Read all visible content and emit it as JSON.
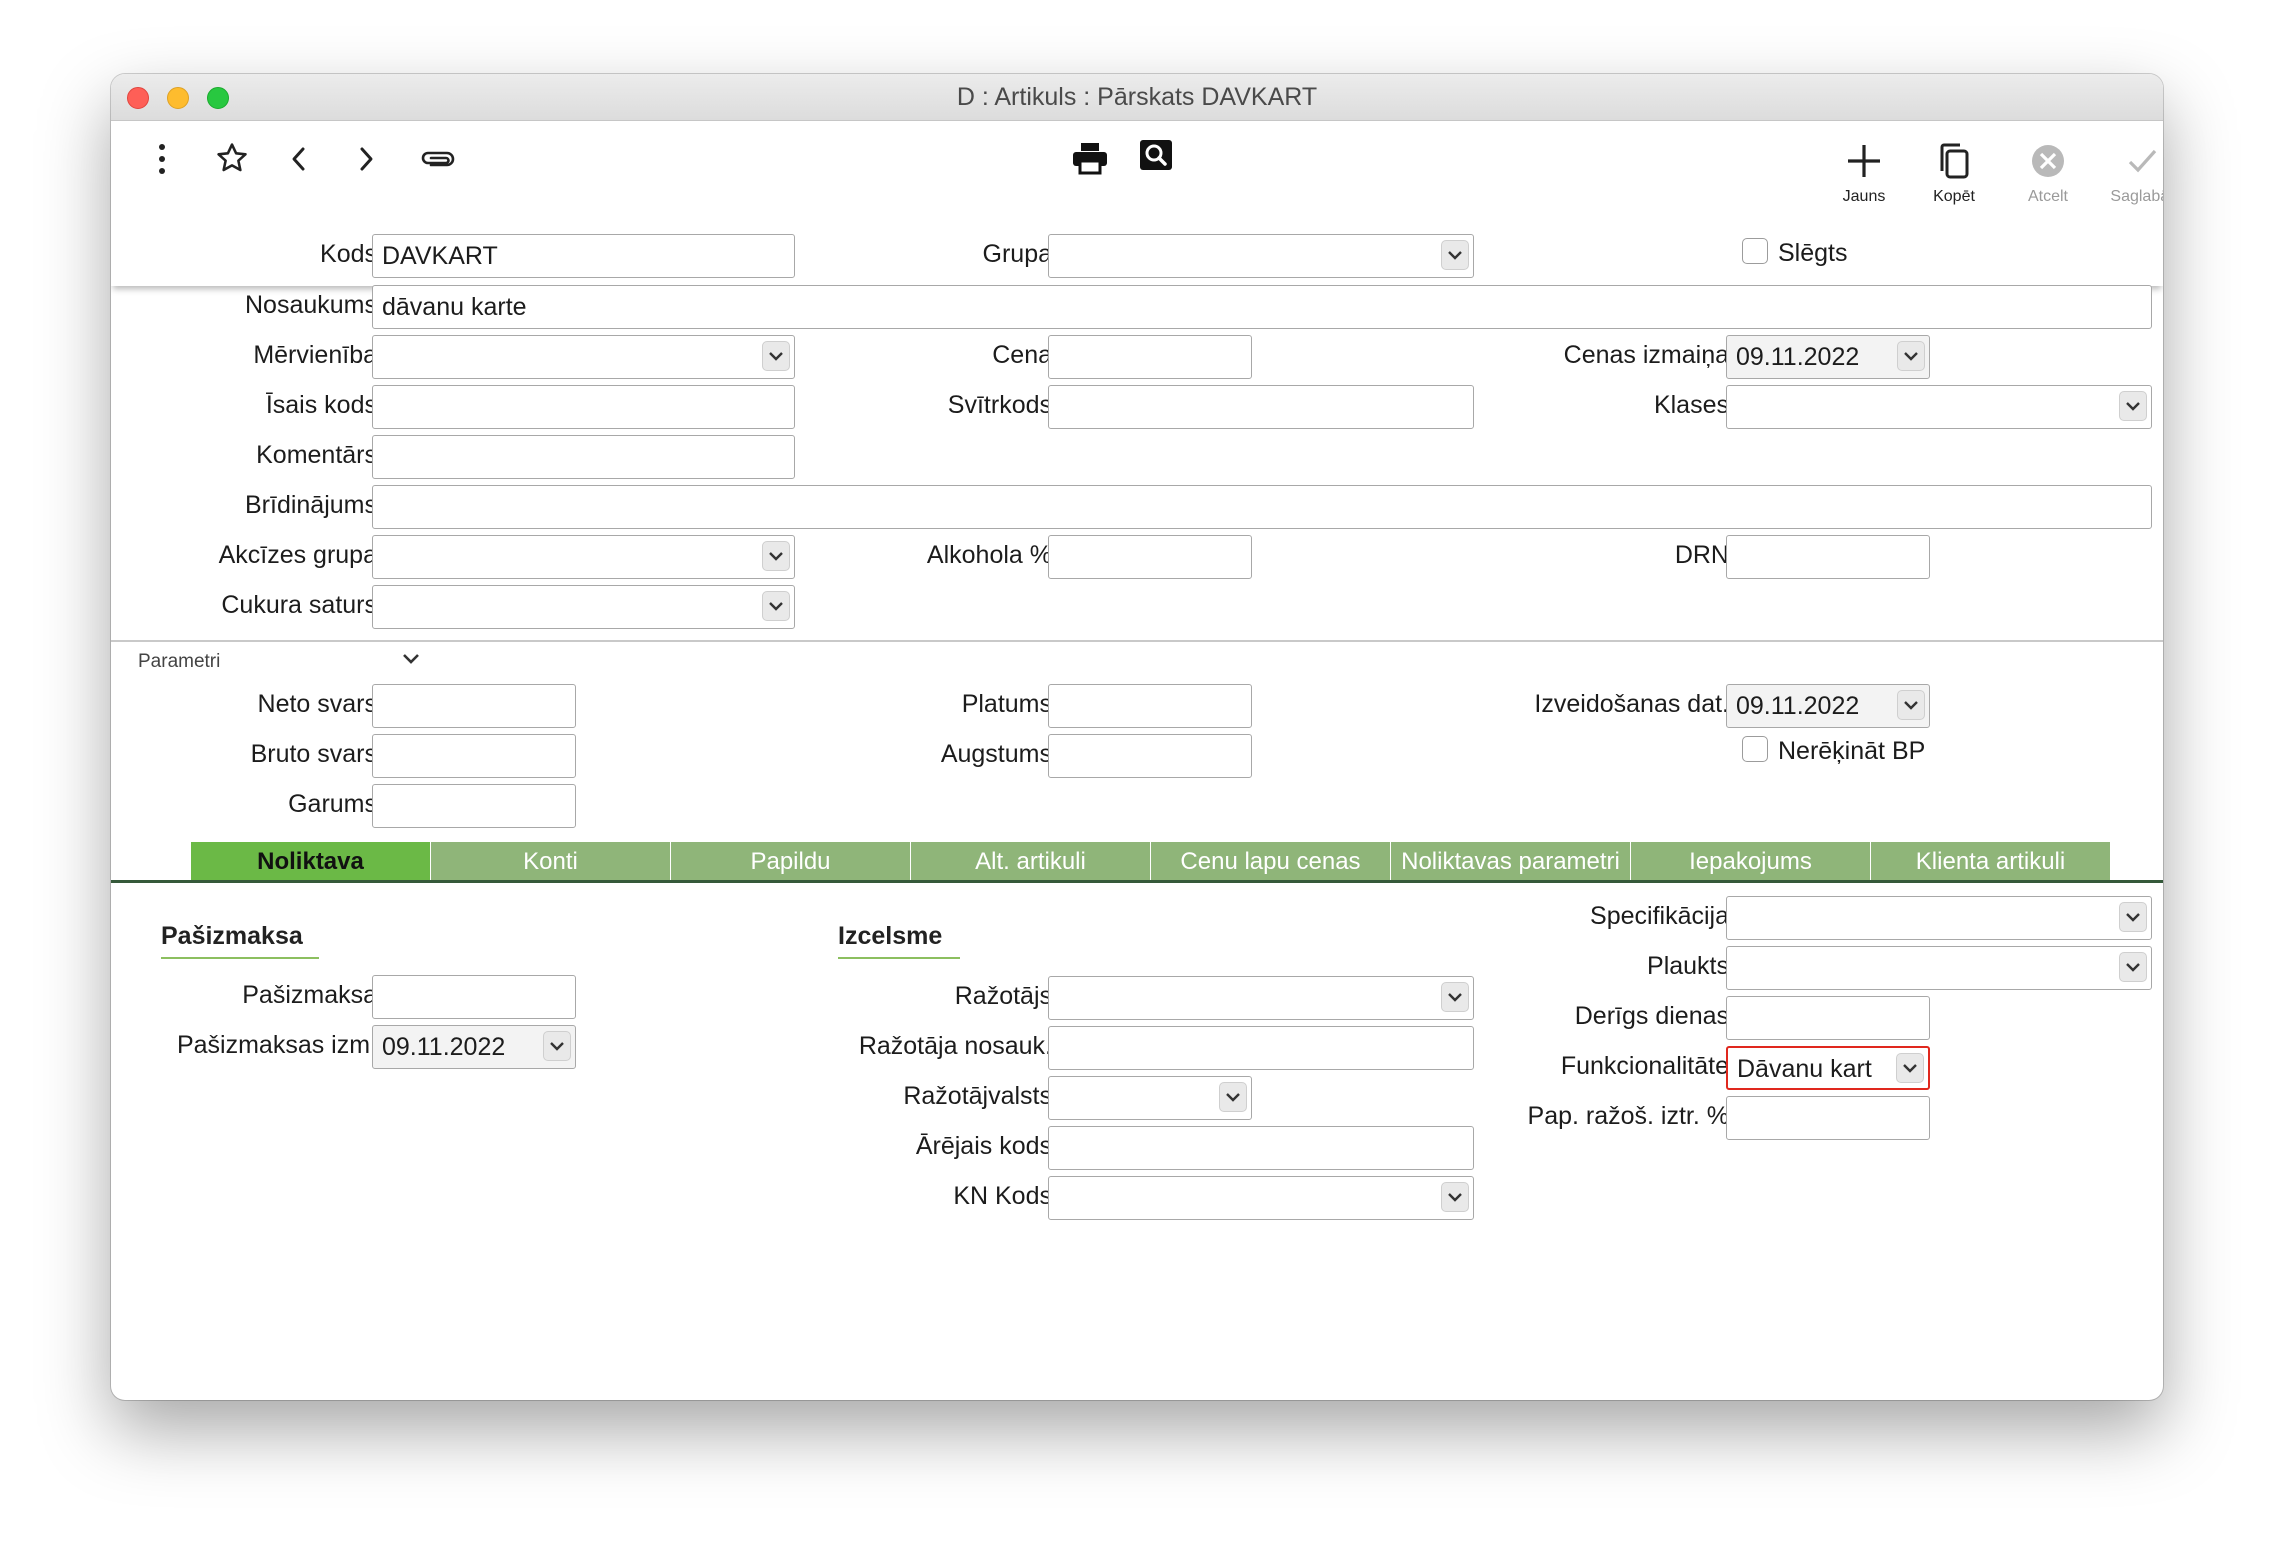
{
  "window": {
    "title": "D : Artikuls : Pārskats DAVKART"
  },
  "toolbar": {
    "new_label": "Jauns",
    "copy_label": "Kopēt",
    "cancel_label": "Atcelt",
    "save_label": "Saglabāt"
  },
  "form": {
    "kods": {
      "label": "Kods",
      "value": "DAVKART"
    },
    "grupa": {
      "label": "Grupa",
      "value": ""
    },
    "slegts": {
      "label": "Slēgts",
      "checked": false
    },
    "nosaukums": {
      "label": "Nosaukums",
      "value": "dāvanu karte"
    },
    "mervieniba": {
      "label": "Mērvienība",
      "value": ""
    },
    "cena": {
      "label": "Cena",
      "value": ""
    },
    "cenas_izmaina": {
      "label": "Cenas izmaiņa",
      "value": "09.11.2022"
    },
    "isais_kods": {
      "label": "Īsais kods",
      "value": ""
    },
    "svitrkods": {
      "label": "Svītrkods",
      "value": ""
    },
    "klases": {
      "label": "Klases",
      "value": ""
    },
    "komentars": {
      "label": "Komentārs",
      "value": ""
    },
    "bridinajums": {
      "label": "Brīdinājums",
      "value": ""
    },
    "akcizes_grupa": {
      "label": "Akcīzes grupa",
      "value": ""
    },
    "alkohola": {
      "label": "Alkohola %",
      "value": ""
    },
    "drn": {
      "label": "DRN",
      "value": ""
    },
    "cukura_saturs": {
      "label": "Cukura saturs",
      "value": ""
    }
  },
  "parametri": {
    "label": "Parametri",
    "neto_svars": {
      "label": "Neto svars",
      "value": ""
    },
    "bruto_svars": {
      "label": "Bruto svars",
      "value": ""
    },
    "garums": {
      "label": "Garums",
      "value": ""
    },
    "platums": {
      "label": "Platums",
      "value": ""
    },
    "augstums": {
      "label": "Augstums",
      "value": ""
    },
    "izveidosanas_dat": {
      "label": "Izveidošanas dat.",
      "value": "09.11.2022"
    },
    "nerekinat_bp": {
      "label": "Nerēķināt BP",
      "checked": false
    }
  },
  "tabs": [
    {
      "label": "Noliktava",
      "active": true
    },
    {
      "label": "Konti",
      "active": false
    },
    {
      "label": "Papildu",
      "active": false
    },
    {
      "label": "Alt. artikuli",
      "active": false
    },
    {
      "label": "Cenu lapu cenas",
      "active": false
    },
    {
      "label": "Noliktavas parametri",
      "active": false
    },
    {
      "label": "Iepakojums",
      "active": false
    },
    {
      "label": "Klienta artikuli",
      "active": false
    }
  ],
  "noliktava": {
    "pasizmaksa_section": "Pašizmaksa",
    "pasizmaksa": {
      "label": "Pašizmaksa",
      "value": ""
    },
    "pasizmaksas_izm": {
      "label": "Pašizmaksas izm.",
      "value": "09.11.2022"
    },
    "izcelsme_section": "Izcelsme",
    "razotajs": {
      "label": "Ražotājs",
      "value": ""
    },
    "razotaja_nosauk": {
      "label": "Ražotāja nosauk.",
      "value": ""
    },
    "razotajvalsts": {
      "label": "Ražotājvalsts",
      "value": ""
    },
    "arejais_kods": {
      "label": "Ārējais kods",
      "value": ""
    },
    "kn_kods": {
      "label": "KN Kods",
      "value": ""
    },
    "specifikacija": {
      "label": "Specifikācija",
      "value": ""
    },
    "plaukts": {
      "label": "Plaukts",
      "value": ""
    },
    "dergs_dienas": {
      "label": "Derīgs dienas",
      "value": ""
    },
    "funkcionalitate": {
      "label": "Funkcionalitāte",
      "value": "Dāvanu kart"
    },
    "pap_razos": {
      "label": "Pap. ražoš. iztr. %",
      "value": ""
    }
  },
  "colors": {
    "tab_inactive": "#8fb579",
    "tab_active": "#6bb946",
    "highlight_border": "#e0281e",
    "section_underline": "#8cbf5f"
  }
}
